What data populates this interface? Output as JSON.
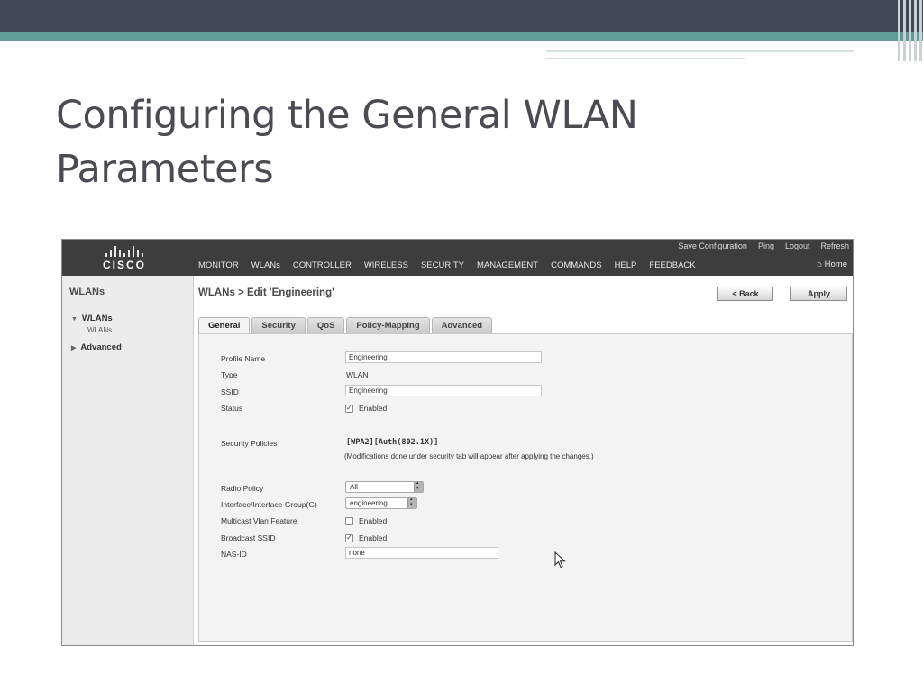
{
  "slide": {
    "title_line1": "Configuring the General WLAN",
    "title_line2": "Parameters"
  },
  "colors": {
    "slide_header": "#434657",
    "slide_accent_teal": "#5f9c98",
    "controller_topbar": "#3d3d3d",
    "panel_background": "#f3f3f3"
  },
  "app": {
    "logo_text": "CISCO",
    "util_links": [
      "Save Configuration",
      "Ping",
      "Logout",
      "Refresh"
    ],
    "nav": [
      "MONITOR",
      "WLANs",
      "CONTROLLER",
      "WIRELESS",
      "SECURITY",
      "MANAGEMENT",
      "COMMANDS",
      "HELP",
      "FEEDBACK"
    ],
    "home": "Home"
  },
  "sidebar": {
    "title": "WLANs",
    "section1": "WLANs",
    "section1_sub": "WLANs",
    "section2": "Advanced"
  },
  "page": {
    "breadcrumb": "WLANs > Edit  'Engineering'",
    "back_button": "< Back",
    "apply_button": "Apply"
  },
  "tabs": [
    "General",
    "Security",
    "QoS",
    "Policy-Mapping",
    "Advanced"
  ],
  "form": {
    "profile_name": {
      "label": "Profile Name",
      "value": "Engineering"
    },
    "type": {
      "label": "Type",
      "value": "WLAN"
    },
    "ssid": {
      "label": "SSID",
      "value": "Engineering"
    },
    "status": {
      "label": "Status",
      "checked": true,
      "check_label": "Enabled"
    },
    "security_policies": {
      "label": "Security Policies",
      "value": "[WPA2][Auth(802.1X)]",
      "note": "(Modifications done under security tab will appear after applying the changes.)"
    },
    "radio_policy": {
      "label": "Radio Policy",
      "value": "All"
    },
    "interface_group": {
      "label": "Interface/Interface Group(G)",
      "value": "engineering"
    },
    "multicast_vlan": {
      "label": "Multicast Vlan Feature",
      "checked": false,
      "check_label": "Enabled"
    },
    "broadcast_ssid": {
      "label": "Broadcast SSID",
      "checked": true,
      "check_label": "Enabled"
    },
    "nas_id": {
      "label": "NAS-ID",
      "value": "none"
    }
  }
}
